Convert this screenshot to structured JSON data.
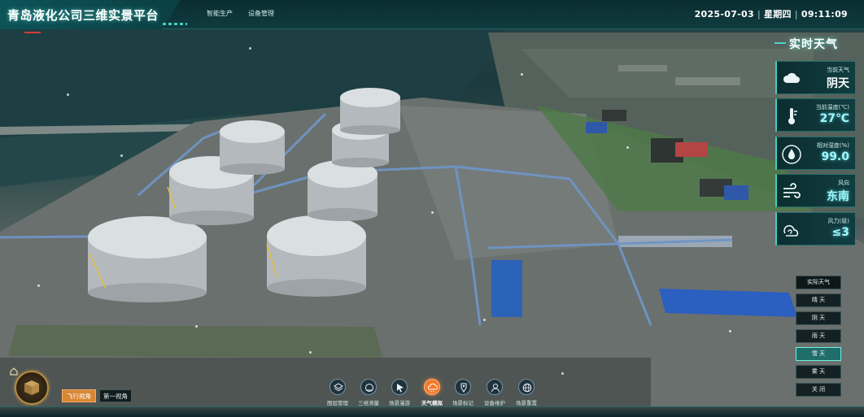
{
  "header": {
    "title": "青岛液化公司三维实景平台",
    "nav": [
      "智能生产",
      "设备管理"
    ],
    "date": "2025-07-03",
    "weekday": "星期四",
    "time": "09:11:09"
  },
  "weather": {
    "panel_title": "实时天气",
    "cards": [
      {
        "label": "当前天气",
        "value": "阴天",
        "icon": "cloud-icon"
      },
      {
        "label": "当前温度(℃)",
        "value": "27℃",
        "icon": "thermometer-icon"
      },
      {
        "label": "相对湿度(%)",
        "value": "99.0",
        "icon": "humidity-drop-icon"
      },
      {
        "label": "风向",
        "value": "东南",
        "icon": "wind-direction-icon"
      },
      {
        "label": "风力(级)",
        "value": "≤3",
        "icon": "wind-force-icon"
      }
    ],
    "options": [
      "实际天气",
      "晴 天",
      "阴 天",
      "雨 天",
      "雪 天",
      "雾 天",
      "关 闭"
    ],
    "active_option": "雪 天"
  },
  "toolbar": {
    "items": [
      {
        "label": "图层管理",
        "icon": "layers-icon"
      },
      {
        "label": "三维测量",
        "icon": "measure-icon"
      },
      {
        "label": "场景漫游",
        "icon": "cursor-icon"
      },
      {
        "label": "天气模拟",
        "icon": "weather-sim-icon"
      },
      {
        "label": "场景标记",
        "icon": "marker-icon"
      },
      {
        "label": "设备维护",
        "icon": "maintenance-icon"
      },
      {
        "label": "场景重置",
        "icon": "reset-globe-icon"
      }
    ],
    "active": "天气模拟"
  },
  "view": {
    "buttons": [
      "飞行视角",
      "第一视角"
    ],
    "active": "飞行视角"
  },
  "colors": {
    "accent": "#3fd0c0",
    "active_orange": "#f37a2c",
    "header_bg": "#0b3f43"
  }
}
